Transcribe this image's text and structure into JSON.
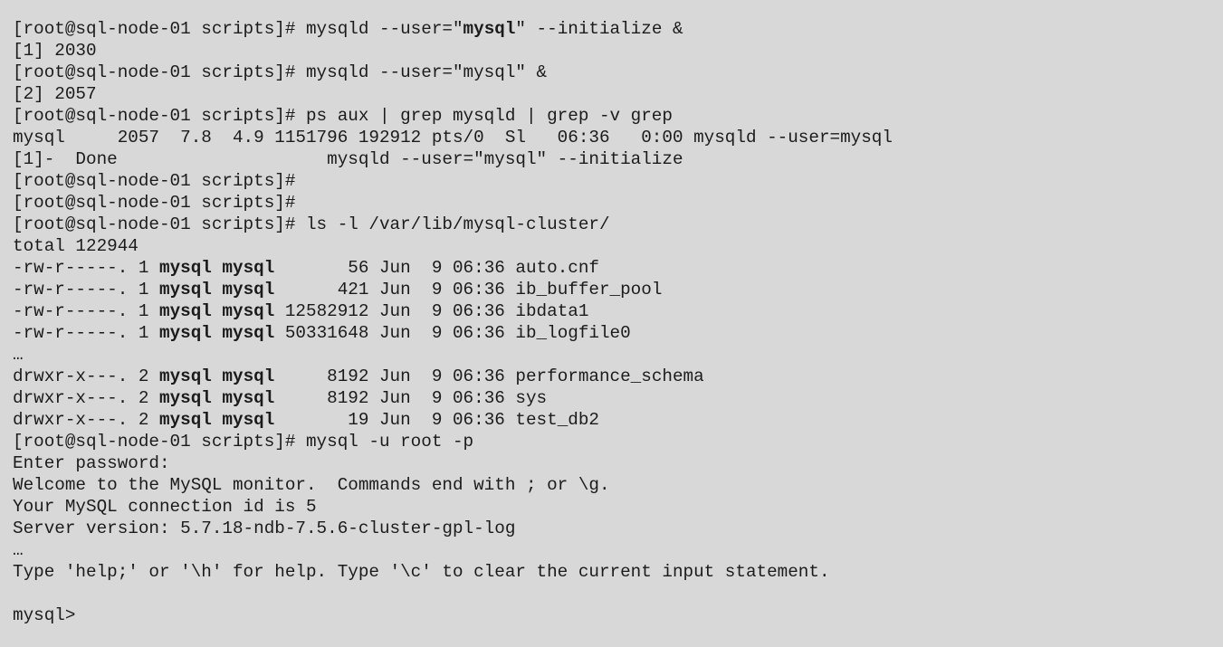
{
  "terminal": {
    "background": "#d8d8d8",
    "foreground": "#1b1b1b",
    "lines": [
      {
        "segments": [
          {
            "t": "[root@sql-node-01 scripts]# mysqld --user=\""
          },
          {
            "t": "mysql",
            "b": true
          },
          {
            "t": "\" --initialize &"
          }
        ]
      },
      {
        "segments": [
          {
            "t": "[1] 2030"
          }
        ]
      },
      {
        "segments": [
          {
            "t": "[root@sql-node-01 scripts]# mysqld --user=\"mysql\" &"
          }
        ]
      },
      {
        "segments": [
          {
            "t": "[2] 2057"
          }
        ]
      },
      {
        "segments": [
          {
            "t": "[root@sql-node-01 scripts]# ps aux | grep mysqld | grep -v grep"
          }
        ]
      },
      {
        "segments": [
          {
            "t": "mysql     2057  7.8  4.9 1151796 192912 pts/0  Sl   06:36   0:00 mysqld --user=mysql"
          }
        ]
      },
      {
        "segments": [
          {
            "t": "[1]-  Done                    mysqld --user=\"mysql\" --initialize"
          }
        ]
      },
      {
        "segments": [
          {
            "t": "[root@sql-node-01 scripts]#"
          }
        ]
      },
      {
        "segments": [
          {
            "t": "[root@sql-node-01 scripts]#"
          }
        ]
      },
      {
        "segments": [
          {
            "t": "[root@sql-node-01 scripts]# ls -l /var/lib/mysql-cluster/"
          }
        ]
      },
      {
        "segments": [
          {
            "t": "total 122944"
          }
        ]
      },
      {
        "segments": [
          {
            "t": "-rw-r-----. 1 "
          },
          {
            "t": "mysql mysql",
            "b": true
          },
          {
            "t": "       56 Jun  9 06:36 auto.cnf"
          }
        ]
      },
      {
        "segments": [
          {
            "t": "-rw-r-----. 1 "
          },
          {
            "t": "mysql mysql",
            "b": true
          },
          {
            "t": "      421 Jun  9 06:36 ib_buffer_pool"
          }
        ]
      },
      {
        "segments": [
          {
            "t": "-rw-r-----. 1 "
          },
          {
            "t": "mysql mysql",
            "b": true
          },
          {
            "t": " 12582912 Jun  9 06:36 ibdata1"
          }
        ]
      },
      {
        "segments": [
          {
            "t": "-rw-r-----. 1 "
          },
          {
            "t": "mysql mysql",
            "b": true
          },
          {
            "t": " 50331648 Jun  9 06:36 ib_logfile0"
          }
        ]
      },
      {
        "segments": [
          {
            "t": "…"
          }
        ]
      },
      {
        "segments": [
          {
            "t": "drwxr-x---. 2 "
          },
          {
            "t": "mysql mysql",
            "b": true
          },
          {
            "t": "     8192 Jun  9 06:36 performance_schema"
          }
        ]
      },
      {
        "segments": [
          {
            "t": "drwxr-x---. 2 "
          },
          {
            "t": "mysql mysql",
            "b": true
          },
          {
            "t": "     8192 Jun  9 06:36 sys"
          }
        ]
      },
      {
        "segments": [
          {
            "t": "drwxr-x---. 2 "
          },
          {
            "t": "mysql mysql",
            "b": true
          },
          {
            "t": "       19 Jun  9 06:36 test_db2"
          }
        ]
      },
      {
        "segments": [
          {
            "t": "[root@sql-node-01 scripts]# mysql -u root -p"
          }
        ]
      },
      {
        "segments": [
          {
            "t": "Enter password:"
          }
        ]
      },
      {
        "segments": [
          {
            "t": "Welcome to the MySQL monitor.  Commands end with ; or \\g."
          }
        ]
      },
      {
        "segments": [
          {
            "t": "Your MySQL connection id is 5"
          }
        ]
      },
      {
        "segments": [
          {
            "t": "Server version: 5.7.18-ndb-7.5.6-cluster-gpl-log"
          }
        ]
      },
      {
        "segments": [
          {
            "t": "…"
          }
        ]
      },
      {
        "segments": [
          {
            "t": "Type 'help;' or '\\h' for help. Type '\\c' to clear the current input statement."
          }
        ]
      },
      {
        "segments": [
          {
            "t": ""
          }
        ]
      },
      {
        "segments": [
          {
            "t": "mysql>"
          }
        ]
      }
    ]
  }
}
